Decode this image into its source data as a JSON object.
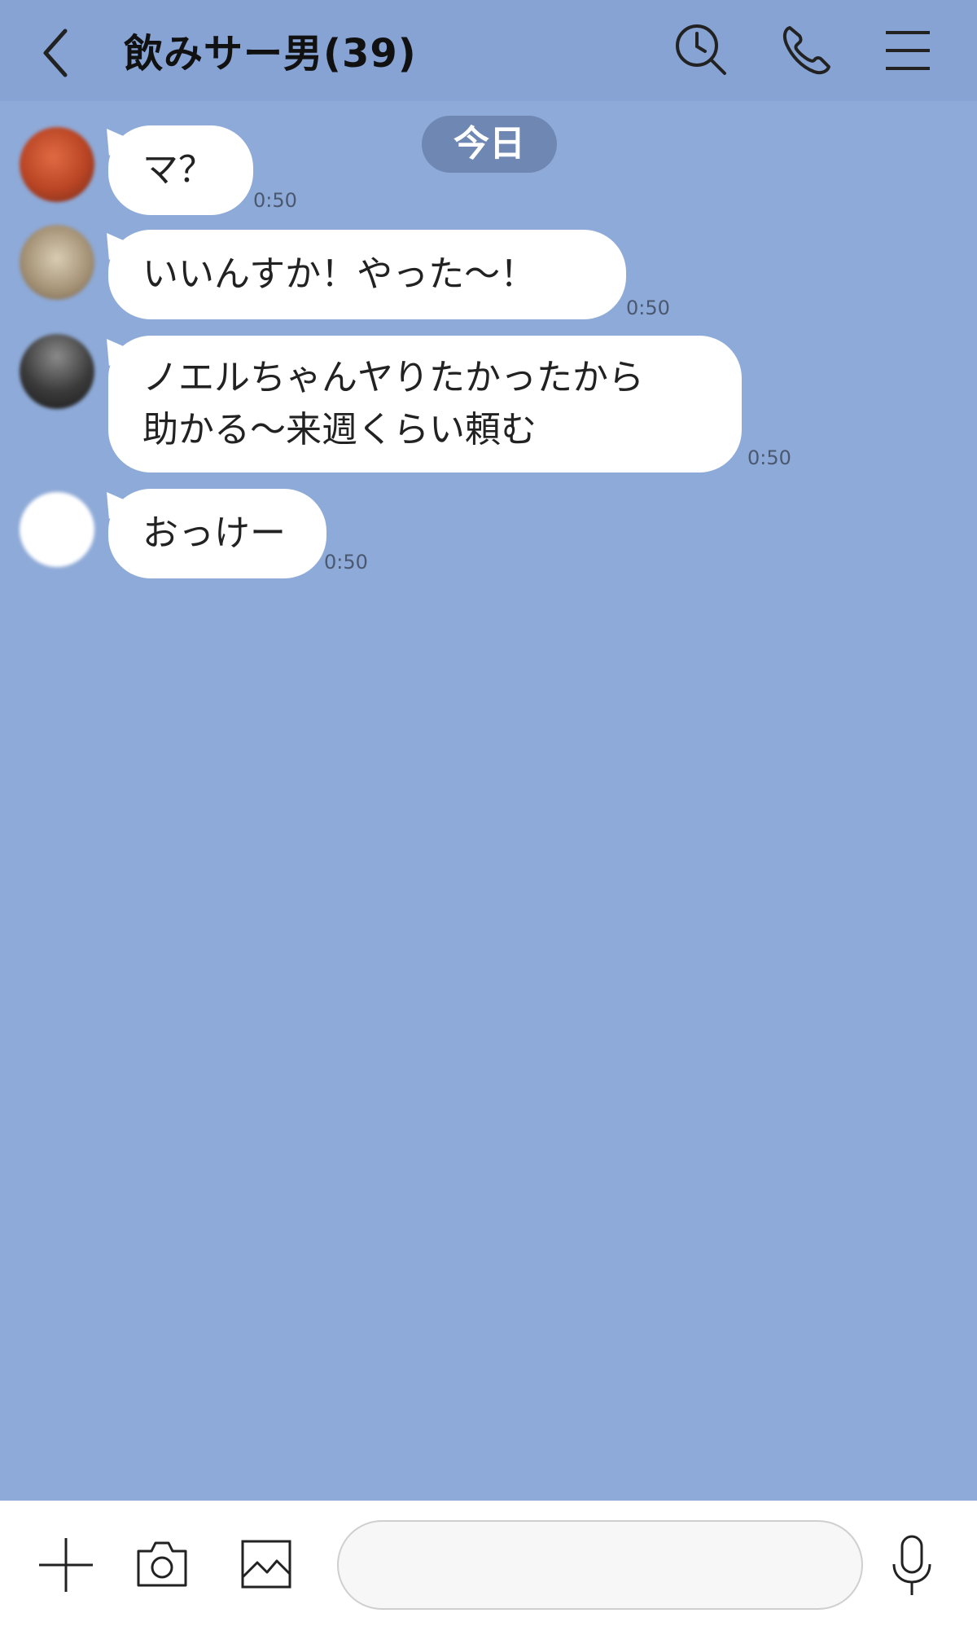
{
  "header": {
    "title": "飲みサー男(39)"
  },
  "date_separator": "今日",
  "messages": [
    {
      "text": "マ？",
      "time": "0:50"
    },
    {
      "text": "いいんすか！やった〜！",
      "time": "0:50"
    },
    {
      "text_line1": "ノエルちゃんヤりたかったから",
      "text_line2": "助かる〜来週くらい頼む",
      "time": "0:50"
    },
    {
      "text": "おっけー",
      "time": "0:50"
    }
  ],
  "composer": {
    "placeholder": ""
  },
  "colors": {
    "background": "#8eaad8",
    "header": "#86a3d3",
    "date_pill": "#6f88b3",
    "bubble": "#ffffff"
  },
  "icons": [
    "back-chevron-icon",
    "search-icon",
    "phone-icon",
    "menu-icon",
    "plus-icon",
    "camera-icon",
    "image-icon",
    "microphone-icon"
  ]
}
